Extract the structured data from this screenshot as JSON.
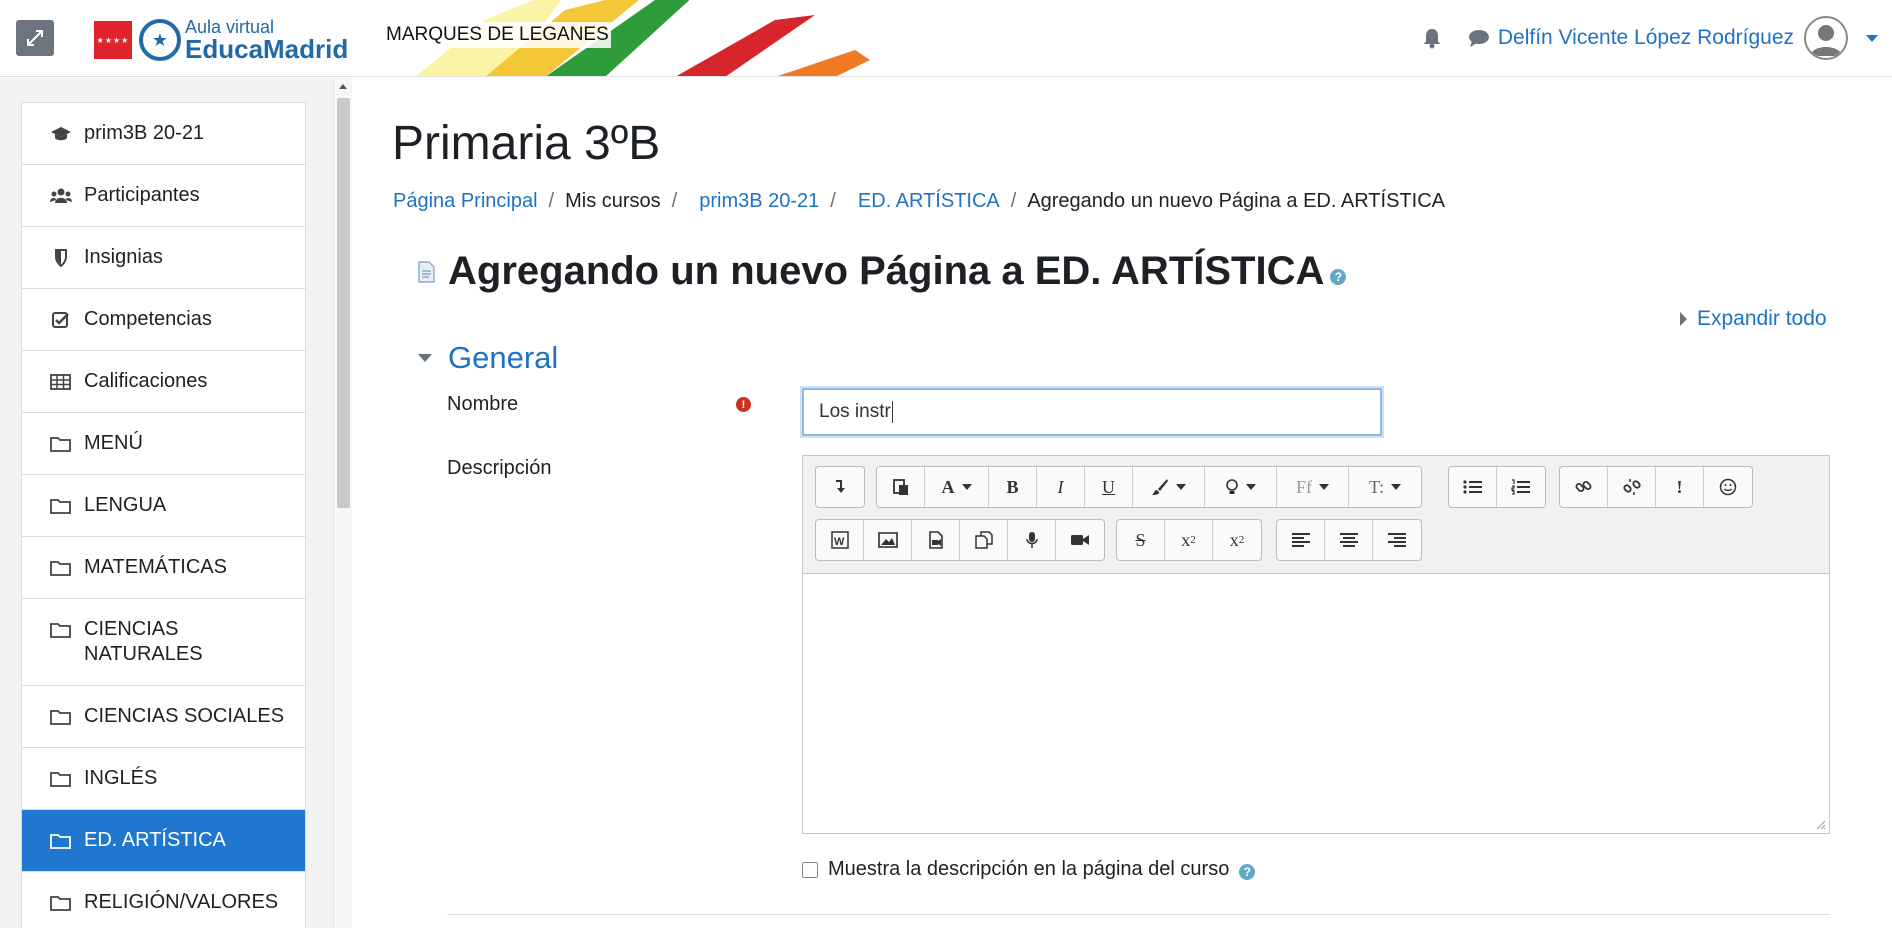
{
  "header": {
    "logo": {
      "small": "Aula virtual",
      "big": "EducaMadrid"
    },
    "site_name": "MARQUES DE LEGANES",
    "user_name": "Delfín Vicente López Rodríguez",
    "stripe_colors": [
      "#f6e36a",
      "#f2b21c",
      "#2e9c3b",
      "#d7262b",
      "#f07a22"
    ]
  },
  "sidebar": {
    "items": [
      {
        "label": "prim3B 20-21",
        "icon": "graduation-cap-icon",
        "active": false
      },
      {
        "label": "Participantes",
        "icon": "users-icon",
        "active": false
      },
      {
        "label": "Insignias",
        "icon": "shield-icon",
        "active": false
      },
      {
        "label": "Competencias",
        "icon": "check-square-icon",
        "active": false
      },
      {
        "label": "Calificaciones",
        "icon": "table-icon",
        "active": false
      },
      {
        "label": "MENÚ",
        "icon": "folder-icon",
        "active": false
      },
      {
        "label": "LENGUA",
        "icon": "folder-icon",
        "active": false
      },
      {
        "label": "MATEMÁTICAS",
        "icon": "folder-icon",
        "active": false
      },
      {
        "label": "CIENCIAS NATURALES",
        "icon": "folder-icon",
        "active": false
      },
      {
        "label": "CIENCIAS SOCIALES",
        "icon": "folder-icon",
        "active": false
      },
      {
        "label": "INGLÉS",
        "icon": "folder-icon",
        "active": false
      },
      {
        "label": "ED. ARTÍSTICA",
        "icon": "folder-icon",
        "active": true
      },
      {
        "label": "RELIGIÓN/VALORES",
        "icon": "folder-icon",
        "active": false
      }
    ]
  },
  "main": {
    "course_title": "Primaria 3ºB",
    "breadcrumb": {
      "home": "Página Principal",
      "my_courses": "Mis cursos",
      "course": "prim3B 20-21",
      "section": "ED. ARTÍSTICA",
      "current": "Agregando un nuevo Página a ED. ARTÍSTICA",
      "separator": "/"
    },
    "page_heading": "Agregando un nuevo Página a ED. ARTÍSTICA",
    "expand_all": "Expandir todo",
    "section_general": "General",
    "form": {
      "nombre_label": "Nombre",
      "nombre_value": "Los instr",
      "descripcion_label": "Descripción",
      "show_description_label": "Muestra la descripción en la página del curso"
    }
  },
  "colors": {
    "accent": "#1f72c4",
    "active_bg": "#1f77d0",
    "required": "#ca3120"
  }
}
